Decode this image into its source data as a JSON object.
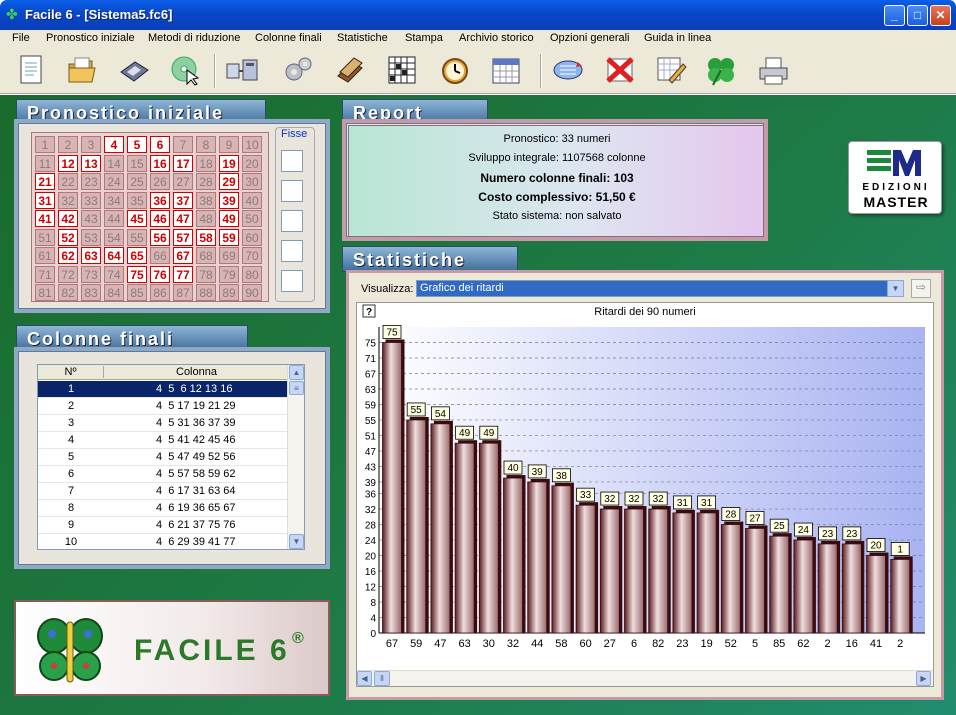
{
  "window": {
    "title": "Facile 6 - [Sistema5.fc6]"
  },
  "menu": [
    "File",
    "Pronostico iniziale",
    "Metodi di riduzione",
    "Colonne finali",
    "Statistiche",
    "Stampa",
    "Archivio storico",
    "Opzioni generali",
    "Guida in linea"
  ],
  "toolbar": {
    "icons": [
      "new-document-icon",
      "open-folder-icon",
      "save-disk-icon",
      "cd-cursor-icon",
      "filter-machine-icon",
      "gears-icon",
      "archive-books-icon",
      "grid-icon",
      "clock-icon",
      "calendar-icon",
      "refresh-lotto-icon",
      "delete-x-icon",
      "edit-pencil-icon",
      "clover-icon",
      "printer-icon"
    ]
  },
  "pronostico": {
    "title": "Pronostico iniziale",
    "selected": [
      4,
      5,
      6,
      12,
      13,
      16,
      17,
      19,
      21,
      29,
      31,
      36,
      37,
      39,
      41,
      42,
      45,
      46,
      47,
      49,
      52,
      56,
      57,
      58,
      59,
      62,
      63,
      64,
      65,
      67,
      75,
      76,
      77
    ],
    "fisse_label": "Fisse"
  },
  "colonne": {
    "title": "Colonne finali",
    "headers": [
      "Nº",
      "Colonna"
    ],
    "rows": [
      {
        "n": "1",
        "col": "4  5  6 12 13 16"
      },
      {
        "n": "2",
        "col": "4  5 17 19 21 29"
      },
      {
        "n": "3",
        "col": "4  5 31 36 37 39"
      },
      {
        "n": "4",
        "col": "4  5 41 42 45 46"
      },
      {
        "n": "5",
        "col": "4  5 47 49 52 56"
      },
      {
        "n": "6",
        "col": "4  5 57 58 59 62"
      },
      {
        "n": "7",
        "col": "4  6 17 31 63 64"
      },
      {
        "n": "8",
        "col": "4  6 19 36 65 67"
      },
      {
        "n": "9",
        "col": "4  6 21 37 75 76"
      },
      {
        "n": "10",
        "col": "4  6 29 39 41 77"
      }
    ]
  },
  "logo": {
    "text": "FACILE 6",
    "reg": "®"
  },
  "report": {
    "title": "Report",
    "line1": "Pronostico: 33 numeri",
    "line2": "Sviluppo integrale: 1107568 colonne",
    "line3": "Numero colonne finali: 103",
    "line4": "Costo complessivo: 51,50 €",
    "line5": "Stato sistema: non salvato"
  },
  "edizioni": {
    "line1": "EDIZIONI",
    "line2": "MASTER"
  },
  "statistiche": {
    "title": "Statistiche",
    "visualizza_label": "Visualizza:",
    "combo_value": "Grafico dei ritardi",
    "help": "?"
  },
  "colors": {
    "bar_dark": "#5a1a1e",
    "bar_light": "#f0dede",
    "accent_red": "#d00000"
  },
  "chart_data": {
    "type": "bar",
    "title": "Ritardi dei 90 numeri",
    "categories": [
      "67",
      "59",
      "47",
      "63",
      "30",
      "32",
      "44",
      "58",
      "60",
      "27",
      "6",
      "82",
      "23",
      "19",
      "52",
      "5",
      "85",
      "62",
      "2",
      "16",
      "41",
      "2"
    ],
    "values": [
      75,
      55,
      54,
      49,
      49,
      40,
      39,
      38,
      33,
      32,
      32,
      32,
      31,
      31,
      28,
      27,
      25,
      24,
      23,
      23,
      20,
      19
    ],
    "value_labels": [
      "75",
      "55",
      "54",
      "49",
      "49",
      "40",
      "39",
      "38",
      "33",
      "32",
      "32",
      "32",
      "31",
      "31",
      "28",
      "27",
      "25",
      "24",
      "23",
      "23",
      "20",
      "1"
    ],
    "yticks": [
      0,
      4,
      8,
      12,
      16,
      20,
      24,
      28,
      32,
      36,
      39,
      43,
      47,
      51,
      55,
      59,
      63,
      67,
      71,
      75
    ],
    "ylim": [
      0,
      79
    ],
    "grid": true,
    "xlabel": "",
    "ylabel": ""
  }
}
